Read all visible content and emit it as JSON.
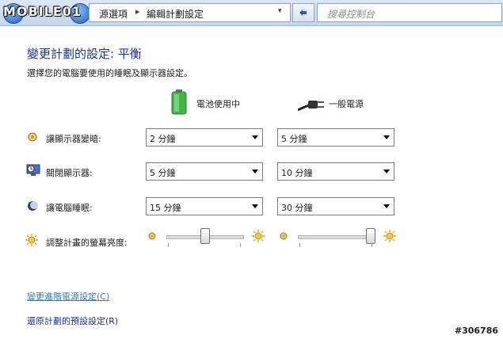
{
  "watermark": {
    "logo_text": "MOBILE01",
    "image_id": "#306786"
  },
  "address_bar": {
    "crumbs": [
      "源選項",
      "編輯計劃設定"
    ],
    "separator": "▸",
    "dropdown_glyph": "▾"
  },
  "search": {
    "placeholder": "搜尋控制台"
  },
  "page": {
    "title": "變更計劃的設定: 平衡",
    "subtitle": "選擇您的電腦要使用的睡眠及顯示器設定。"
  },
  "columns": {
    "battery_label": "電池使用中",
    "plugged_label": "一般電源"
  },
  "rows": [
    {
      "label": "讓顯示器變暗:",
      "battery": "2 分鐘",
      "plugged": "5 分鐘",
      "icon": "dim-display-icon"
    },
    {
      "label": "關閉顯示器:",
      "battery": "5 分鐘",
      "plugged": "10 分鐘",
      "icon": "monitor-clock-icon"
    },
    {
      "label": "讓電腦睡眠:",
      "battery": "15 分鐘",
      "plugged": "30 分鐘",
      "icon": "moon-icon"
    }
  ],
  "brightness": {
    "label": "調整計畫的螢幕亮度:",
    "battery_level": 0.5,
    "plugged_level": 1.0
  },
  "links": {
    "advanced": "變更進階電源設定(C)",
    "restore": "還原計劃的預設設定(R)"
  },
  "colors": {
    "title": "#1e3287",
    "link": "#3c7bbf",
    "battery_green": "#3fb54a"
  }
}
